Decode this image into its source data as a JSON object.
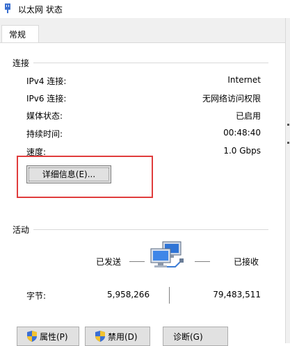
{
  "window": {
    "title": "以太网 状态"
  },
  "tabs": [
    {
      "label": "常规"
    }
  ],
  "connection": {
    "section_title": "连接",
    "rows": [
      {
        "label": "IPv4 连接:",
        "value": "Internet"
      },
      {
        "label": "IPv6 连接:",
        "value": "无网络访问权限"
      },
      {
        "label": "媒体状态:",
        "value": "已启用"
      },
      {
        "label": "持续时间:",
        "value": "00:48:40"
      },
      {
        "label": "速度:",
        "value": "1.0 Gbps"
      }
    ],
    "details_button": "详细信息(E)..."
  },
  "activity": {
    "section_title": "活动",
    "sent_label": "已发送",
    "received_label": "已接收",
    "bytes_label": "字节:",
    "bytes_sent": "5,958,266",
    "bytes_received": "79,483,511"
  },
  "buttons": {
    "properties": "属性(P)",
    "disable": "禁用(D)",
    "diagnose": "诊断(G)"
  },
  "colors": {
    "highlight": "#e03c3c",
    "button_face": "#e1e1e1"
  },
  "icons": [
    "network-adapter-icon",
    "network-computers-icon",
    "uac-shield-icon"
  ]
}
